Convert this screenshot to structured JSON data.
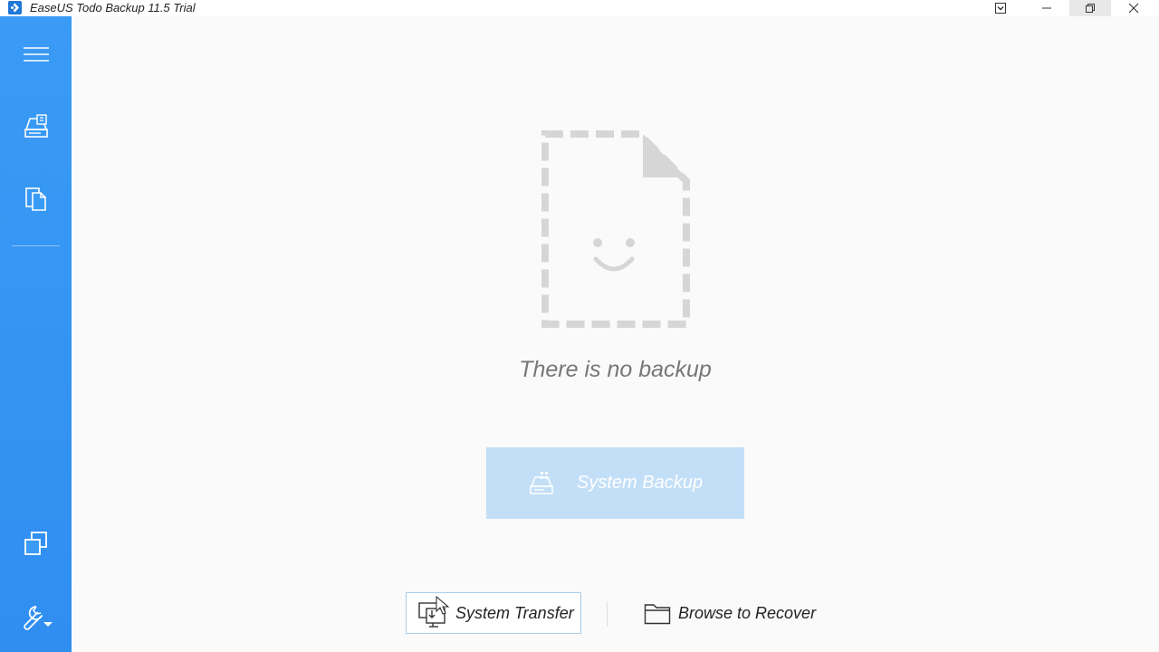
{
  "window": {
    "title": "EaseUS Todo Backup 11.5 Trial",
    "icons": {
      "app": "easeus-app-icon",
      "dropdown": "dropdown-box-icon",
      "minimize": "minimize-icon",
      "restore": "restore-icon",
      "close": "close-icon"
    }
  },
  "sidebar": {
    "accent": "#3a9bf5",
    "items": [
      {
        "name": "menu",
        "icon": "hamburger-menu-icon"
      },
      {
        "name": "backup",
        "icon": "disk-backup-icon"
      },
      {
        "name": "clone",
        "icon": "clone-documents-icon"
      },
      {
        "name": "windows",
        "icon": "windows-icon"
      },
      {
        "name": "tools",
        "icon": "wrench-dropdown-icon"
      }
    ]
  },
  "main": {
    "empty_text": "There is no backup",
    "empty_icon": "empty-file-smiley-icon",
    "primary_button": {
      "label": "System Backup",
      "icon": "system-backup-icon",
      "color": "#c3dff7"
    },
    "secondary_buttons": [
      {
        "label": "System Transfer",
        "icon": "system-transfer-icon"
      },
      {
        "label": "Browse to Recover",
        "icon": "folder-icon"
      }
    ]
  }
}
